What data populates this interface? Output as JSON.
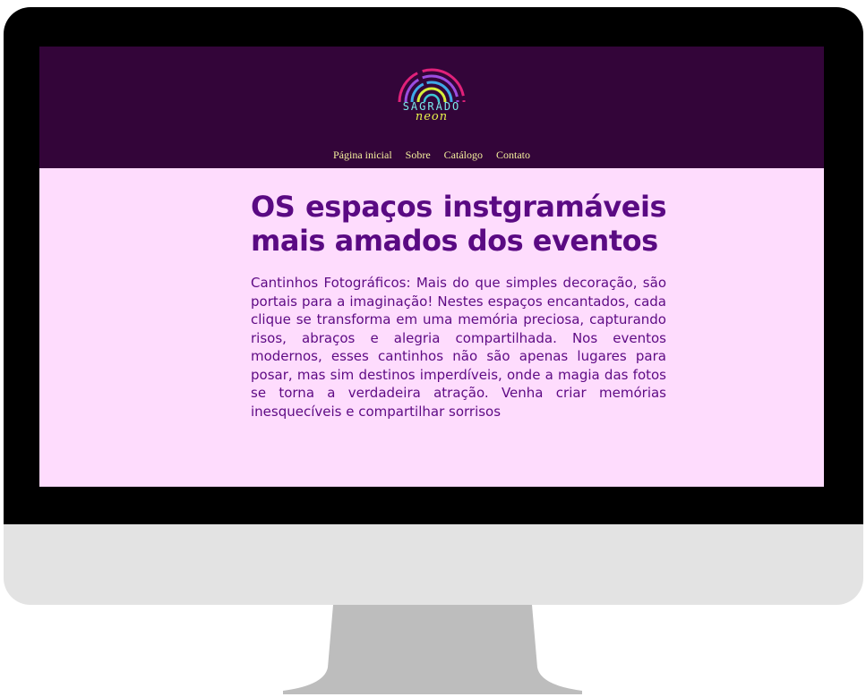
{
  "logo": {
    "word": "SAGRADO",
    "script": "neon"
  },
  "nav": {
    "items": [
      "Página inicial",
      "Sobre",
      "Catálogo",
      "Contato"
    ]
  },
  "main": {
    "headline": "OS espaços instgramáveis mais amados dos eventos",
    "paragraph": "Cantinhos Fotográficos: Mais do que simples decoração, são portais para a imaginação! Nestes espaços encantados, cada clique se transforma em uma memória preciosa, capturando risos, abraços e alegria compartilhada. Nos eventos modernos, esses cantinhos não são apenas lugares para posar, mas sim destinos imperdíveis, onde a magia das fotos se torna a verdadeira atração. Venha criar memórias inesquecíveis e compartilhar sorrisos"
  },
  "colors": {
    "header_bg": "#330539",
    "page_bg": "#fedcfd",
    "nav_text": "#f4ef9c",
    "heading_text": "#5a0a83",
    "bezel": "#000000",
    "chin": "#e3e3e3",
    "stand": "#bdbdbd"
  }
}
